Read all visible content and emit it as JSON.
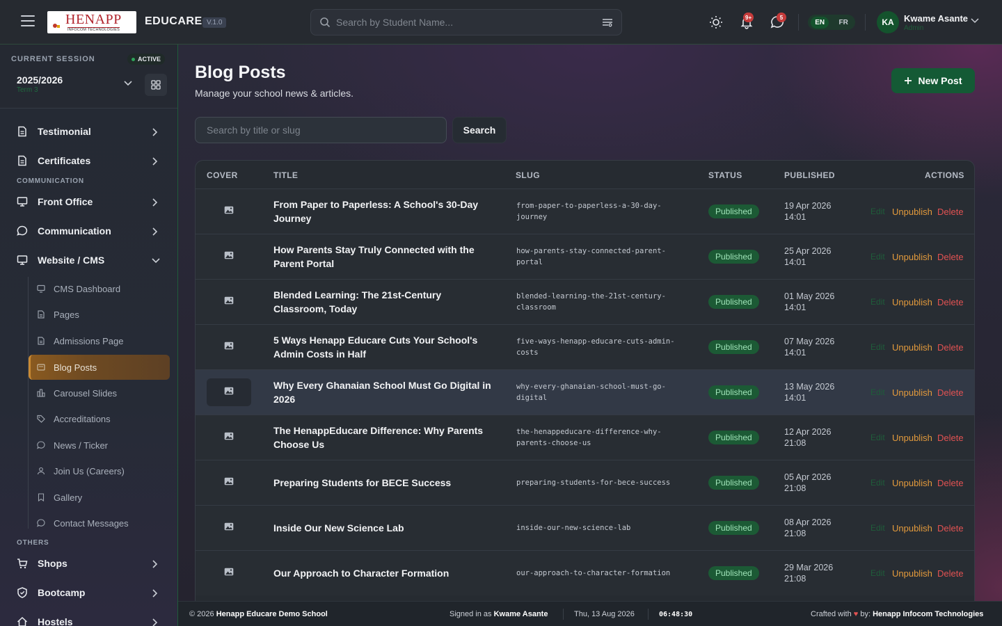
{
  "topbar": {
    "logo_main": "HENAPP",
    "logo_sub": "INFOCOM TECHNOLOGIES",
    "brand": "EDUCARE",
    "version": "V.1.0",
    "search_placeholder": "Search by Student Name...",
    "notifications_badge": "9+",
    "messages_badge": "5",
    "lang_en": "EN",
    "lang_fr": "FR",
    "avatar_initials": "KA",
    "user_name": "Kwame Asante",
    "user_role": "Admin"
  },
  "sidebar": {
    "session_label": "CURRENT SESSION",
    "session_status": "ACTIVE",
    "session_year": "2025/2026",
    "session_term": "Term 3",
    "items_top": [
      {
        "label": "Testimonial",
        "icon": "document-icon"
      },
      {
        "label": "Certificates",
        "icon": "document-icon"
      }
    ],
    "section_communication": "COMMUNICATION",
    "items_comm": [
      {
        "label": "Front Office",
        "icon": "monitor-icon"
      },
      {
        "label": "Communication",
        "icon": "chat-icon"
      },
      {
        "label": "Website / CMS",
        "icon": "monitor-icon"
      }
    ],
    "cms_sub": [
      {
        "label": "CMS Dashboard",
        "icon": "monitor-icon"
      },
      {
        "label": "Pages",
        "icon": "file-icon"
      },
      {
        "label": "Admissions Page",
        "icon": "file-icon"
      },
      {
        "label": "Blog Posts",
        "icon": "newspaper-icon"
      },
      {
        "label": "Carousel Slides",
        "icon": "slides-icon"
      },
      {
        "label": "Accreditations",
        "icon": "tag-icon"
      },
      {
        "label": "News / Ticker",
        "icon": "chat-icon"
      },
      {
        "label": "Join Us (Careers)",
        "icon": "user-icon"
      },
      {
        "label": "Gallery",
        "icon": "bookmark-icon"
      },
      {
        "label": "Contact Messages",
        "icon": "chat-icon"
      }
    ],
    "section_others": "OTHERS",
    "items_others": [
      {
        "label": "Shops",
        "icon": "cart-icon"
      },
      {
        "label": "Bootcamp",
        "icon": "shield-icon"
      },
      {
        "label": "Hostels",
        "icon": "home-icon"
      }
    ]
  },
  "main": {
    "title": "Blog Posts",
    "subtitle": "Manage your school news & articles.",
    "new_post_label": "New Post",
    "filter_placeholder": "Search by title or slug",
    "search_label": "Search",
    "columns": [
      "COVER",
      "TITLE",
      "SLUG",
      "STATUS",
      "PUBLISHED",
      "ACTIONS"
    ],
    "actions": {
      "edit": "Edit",
      "unpublish": "Unpublish",
      "delete": "Delete"
    },
    "rows": [
      {
        "title": "From Paper to Paperless: A School's 30-Day Journey",
        "slug": "from-paper-to-paperless-a-30-day-journey",
        "status": "Published",
        "date": "19 Apr 2026",
        "time": "14:01"
      },
      {
        "title": "How Parents Stay Truly Connected with the Parent Portal",
        "slug": "how-parents-stay-connected-parent-portal",
        "status": "Published",
        "date": "25 Apr 2026",
        "time": "14:01"
      },
      {
        "title": "Blended Learning: The 21st-Century Classroom, Today",
        "slug": "blended-learning-the-21st-century-classroom",
        "status": "Published",
        "date": "01 May 2026",
        "time": "14:01"
      },
      {
        "title": "5 Ways Henapp Educare Cuts Your School's Admin Costs in Half",
        "slug": "five-ways-henapp-educare-cuts-admin-costs",
        "status": "Published",
        "date": "07 May 2026",
        "time": "14:01"
      },
      {
        "title": "Why Every Ghanaian School Must Go Digital in 2026",
        "slug": "why-every-ghanaian-school-must-go-digital",
        "status": "Published",
        "date": "13 May 2026",
        "time": "14:01"
      },
      {
        "title": "The HenappEducare Difference: Why Parents Choose Us",
        "slug": "the-henappeducare-difference-why-parents-choose-us",
        "status": "Published",
        "date": "12 Apr 2026",
        "time": "21:08"
      },
      {
        "title": "Preparing Students for BECE Success",
        "slug": "preparing-students-for-bece-success",
        "status": "Published",
        "date": "05 Apr 2026",
        "time": "21:08"
      },
      {
        "title": "Inside Our New Science Lab",
        "slug": "inside-our-new-science-lab",
        "status": "Published",
        "date": "08 Apr 2026",
        "time": "21:08"
      },
      {
        "title": "Our Approach to Character Formation",
        "slug": "our-approach-to-character-formation",
        "status": "Published",
        "date": "29 Mar 2026",
        "time": "21:08"
      }
    ]
  },
  "footer": {
    "copyright_prefix": "© 2026",
    "school": "Henapp Educare Demo School",
    "signed_in_prefix": "Signed in as",
    "signed_in_user": "Kwame Asante",
    "date": "Thu, 13 Aug 2026",
    "clock": "06:48:30",
    "crafted_prefix": "Crafted with",
    "crafted_by": "by:",
    "company": "Henapp Infocom Technologies"
  },
  "colors": {
    "accent_green": "#145a35",
    "unpublish": "#e39a3c",
    "delete": "#e25252",
    "active_nav": "#8a5a20"
  }
}
